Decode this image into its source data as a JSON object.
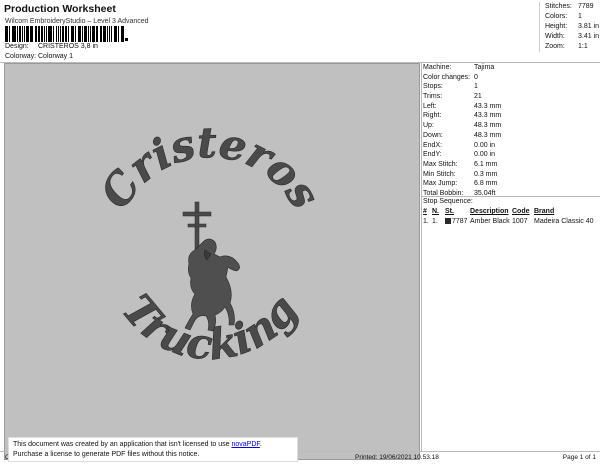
{
  "header": {
    "title": "Production Worksheet",
    "subtitle": "Wilcom EmbroideryStudio – Level 3 Advanced",
    "design_label": "Design:",
    "design_value": "CRISTEROS 3,8 in",
    "colorway_label": "Colorway:",
    "colorway_value": "Colorway 1"
  },
  "top_stats": [
    {
      "label": "Stitches:",
      "value": "7789"
    },
    {
      "label": "Colors:",
      "value": "1"
    },
    {
      "label": "Height:",
      "value": "3.81 in"
    },
    {
      "label": "Width:",
      "value": "3.41 in"
    },
    {
      "label": "Zoom:",
      "value": "1:1"
    }
  ],
  "machine_props": [
    {
      "label": "Machine:",
      "value": "Tajima"
    },
    {
      "label": "Color changes:",
      "value": "0"
    },
    {
      "label": "Stops:",
      "value": "1"
    },
    {
      "label": "Trims:",
      "value": "21"
    },
    {
      "label": "Left:",
      "value": "43.3 mm"
    },
    {
      "label": "Right:",
      "value": "43.3 mm"
    },
    {
      "label": "Up:",
      "value": "48.3 mm"
    },
    {
      "label": "Down:",
      "value": "48.3 mm"
    },
    {
      "label": "EndX:",
      "value": "0.00 in"
    },
    {
      "label": "EndY:",
      "value": "0.00 in"
    },
    {
      "label": "Max Stitch:",
      "value": "6.1 mm"
    },
    {
      "label": "Min Stitch:",
      "value": "0.3 mm"
    },
    {
      "label": "Max Jump:",
      "value": "6.8 mm"
    },
    {
      "label": "Total Bobbin:",
      "value": "35.04ft"
    }
  ],
  "stop_sequence": {
    "title": "Stop Sequence:",
    "headers": [
      "#",
      "N.",
      "St.",
      "Description",
      "Code",
      "Brand"
    ],
    "rows": [
      {
        "num": "1.",
        "n": "1.",
        "st": "7787",
        "description": "Amber Black",
        "code": "1007",
        "brand": "Madeira Classic 40",
        "swatch_color": "#2b2b2b"
      }
    ]
  },
  "design_art": {
    "top_text": "Cristeros",
    "bottom_text": "Trucking",
    "thread_color": "#4a4a4a"
  },
  "notice": {
    "line1_prefix": "This document was created by an application that isn't licensed to use ",
    "link": "novaPDF",
    "line1_suffix": ".",
    "line2": "Purchase a license to generate PDF files without this notice."
  },
  "footer": {
    "left": "Cr",
    "printed": "Printed: 19/06/2021 10.53.18",
    "page": "Page 1 of 1"
  },
  "colors": {
    "canvas_bg": "#c0c0c0"
  }
}
